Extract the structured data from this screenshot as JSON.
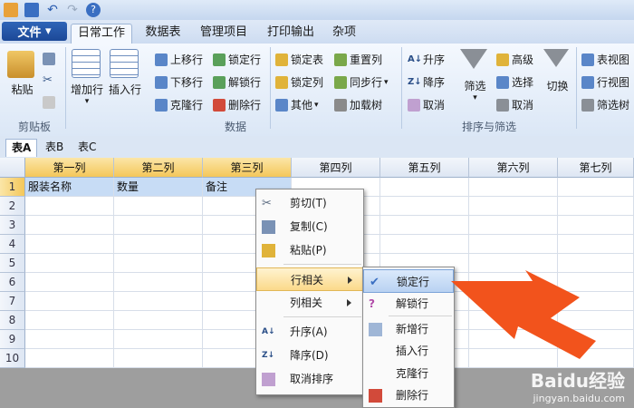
{
  "title_icons": [
    "app-logo-icon",
    "save-icon",
    "undo-icon",
    "redo-icon",
    "help-icon"
  ],
  "menu_tabs": {
    "file": "文件",
    "tabs": [
      "日常工作",
      "数据表",
      "管理项目",
      "打印输出",
      "杂项"
    ]
  },
  "ribbon": {
    "clipboard": {
      "paste": "粘贴",
      "group": "剪贴板"
    },
    "data": {
      "add_row": "增加行",
      "insert_row": "插入行",
      "move_up": "上移行",
      "move_down": "下移行",
      "clone_row": "克隆行",
      "lock_row": "锁定行",
      "unlock_row": "解锁行",
      "delete_row": "删除行",
      "lock_table": "锁定表",
      "lock_col": "锁定列",
      "other": "其他",
      "reset_col": "重置列",
      "sync_row": "同步行",
      "load_tree": "加载树",
      "group": "数据"
    },
    "sort": {
      "asc": "升序",
      "desc": "降序",
      "cancel": "取消",
      "filter": "筛选",
      "advanced": "高级",
      "select": "选择",
      "cancel2": "取消",
      "switch": "切换",
      "group": "排序与筛选"
    },
    "view": {
      "table_view": "表视图",
      "row_view": "行视图",
      "filter_tree": "筛选树"
    }
  },
  "sheet_tabs": [
    "表A",
    "表B",
    "表C"
  ],
  "grid": {
    "columns": [
      "第一列",
      "第二列",
      "第三列",
      "第四列",
      "第五列",
      "第六列",
      "第七列"
    ],
    "rows": [
      "1",
      "2",
      "3",
      "4",
      "5",
      "6",
      "7",
      "8",
      "9",
      "10"
    ],
    "row1": [
      "服装名称",
      "数量",
      "备注",
      "",
      "",
      "",
      ""
    ]
  },
  "context_menu": {
    "cut": "剪切(T)",
    "copy": "复制(C)",
    "paste": "粘贴(P)",
    "row_related": "行相关",
    "col_related": "列相关",
    "sort_asc": "升序(A)",
    "sort_desc": "降序(D)",
    "cancel_sort": "取消排序"
  },
  "submenu": {
    "lock_row": "锁定行",
    "unlock_row": "解锁行",
    "new_row": "新增行",
    "insert_row": "插入行",
    "clone_row": "克隆行",
    "delete_row": "删除行"
  },
  "watermark": {
    "logo": "Baidu经验",
    "url": "jingyan.baidu.com"
  },
  "colors": {
    "accent": "#1c4897",
    "highlight": "#f4c75a",
    "arrow": "#f2531c"
  }
}
